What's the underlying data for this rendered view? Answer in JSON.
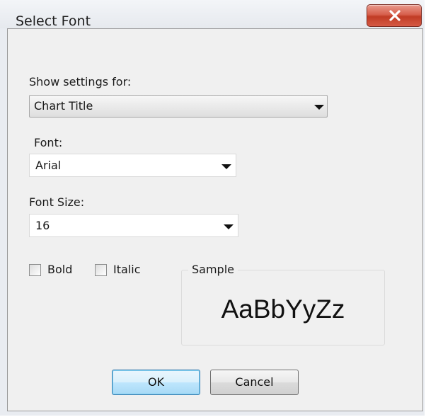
{
  "window": {
    "title": "Select Font",
    "close_symbol": "X"
  },
  "show_settings": {
    "label": "Show settings for:",
    "value": "Chart Title"
  },
  "font": {
    "label": "Font:",
    "value": "Arial"
  },
  "font_size": {
    "label": "Font Size:",
    "value": "16"
  },
  "options": {
    "bold_label": "Bold",
    "bold_checked": false,
    "italic_label": "Italic",
    "italic_checked": false
  },
  "sample": {
    "label": "Sample",
    "text": "AaBbYyZz"
  },
  "buttons": {
    "ok": "OK",
    "cancel": "Cancel"
  },
  "colors": {
    "close_button": "#c13c25",
    "default_button_border": "#3c7fb1",
    "dialog_background": "#f0f0f0"
  },
  "icons": {
    "close": "close-icon",
    "dropdown": "chevron-down-icon"
  }
}
